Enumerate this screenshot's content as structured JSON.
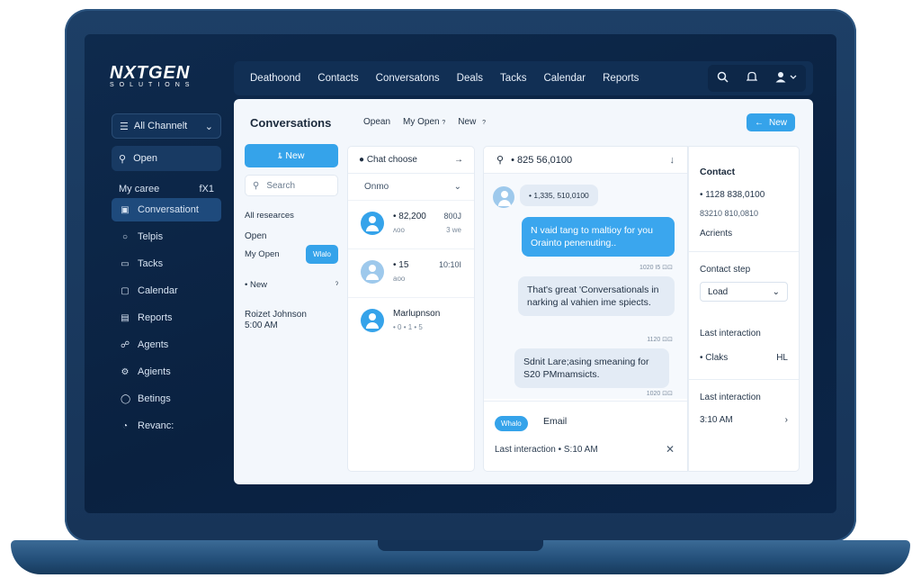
{
  "brand": {
    "name": "NXTGEN",
    "tagline": "SOLUTIONS"
  },
  "topnav": {
    "items": [
      "Deathoond",
      "Contacts",
      "Conversatons",
      "Deals",
      "Tacks",
      "Calendar",
      "Reports"
    ],
    "icons": [
      "search-icon",
      "bell-icon",
      "user-icon"
    ]
  },
  "sidebar": {
    "channel_select": "All Channelt",
    "open_label": "Open",
    "section_label": "My caree",
    "section_count": "fX1",
    "items": [
      {
        "label": "Conversationt",
        "icon": "chat-icon",
        "active": true
      },
      {
        "label": "Telpis",
        "icon": "circle-icon"
      },
      {
        "label": "Tacks",
        "icon": "folder-icon"
      },
      {
        "label": "Calendar",
        "icon": "calendar-icon"
      },
      {
        "label": "Reports",
        "icon": "report-icon"
      },
      {
        "label": "Agents",
        "icon": "agents-icon"
      },
      {
        "label": "Agients",
        "icon": "gear-icon"
      },
      {
        "label": "Betings",
        "icon": "settings-icon"
      },
      {
        "label": "Revanc:",
        "icon": "lock-icon"
      }
    ]
  },
  "panel": {
    "title": "Conversations",
    "tabs": [
      "Opean",
      "My Open",
      "New"
    ],
    "new_button": "New"
  },
  "filters": {
    "new_button": "New",
    "search_placeholder": "Search",
    "all_resources": "All researces",
    "open": "Open",
    "my_open": "My Open",
    "pill": "Wlalo",
    "new_label": "New",
    "contact_name": "Roizet Johnson",
    "contact_time": "5:00 AM"
  },
  "chatlist": {
    "header": "Chat choose",
    "sort": "Onmo",
    "conversations": [
      {
        "name": "• 82,200",
        "sub": "ʌoo",
        "time": "800J",
        "time2": "3 we"
      },
      {
        "name": "• 15",
        "sub": "aoo",
        "time": "10:10I",
        "time2": ""
      },
      {
        "name": "Marlupnson",
        "sub": "• 0 • 1 • 5",
        "time": "",
        "time2": ""
      }
    ]
  },
  "chat": {
    "header": "• 825 56,0100",
    "messages": [
      {
        "direction": "in",
        "text": "• 1,335, 510,0100"
      },
      {
        "direction": "out",
        "text": "N vaid tang to maltioy for you Orainto penenuting..",
        "meta": "1020 I5 ⊡⊡"
      },
      {
        "direction": "in",
        "text": "That's great 'Conversationals in narking al vahien ime spiects.",
        "meta": "1120 ⊡⊡"
      },
      {
        "direction": "in",
        "text": "Sdnit Lare;asing smeaning for S20 PMmamsicts.",
        "meta": "1020 ⊡⊡"
      }
    ],
    "channel_pill": "Whalo",
    "email_label": "Email",
    "last_interaction": "Last interaction • S:10 AM"
  },
  "contact": {
    "title": "Contact",
    "phone": "• 1128 838,0100",
    "phone2": "83210 810,0810",
    "accounts": "Acrients",
    "stage_label": "Contact step",
    "stage_value": "Load",
    "last_label": "Last interaction",
    "status": "• Claks",
    "status_right": "HL",
    "last_label2": "Last interaction",
    "last_time": "3:10 AM"
  }
}
